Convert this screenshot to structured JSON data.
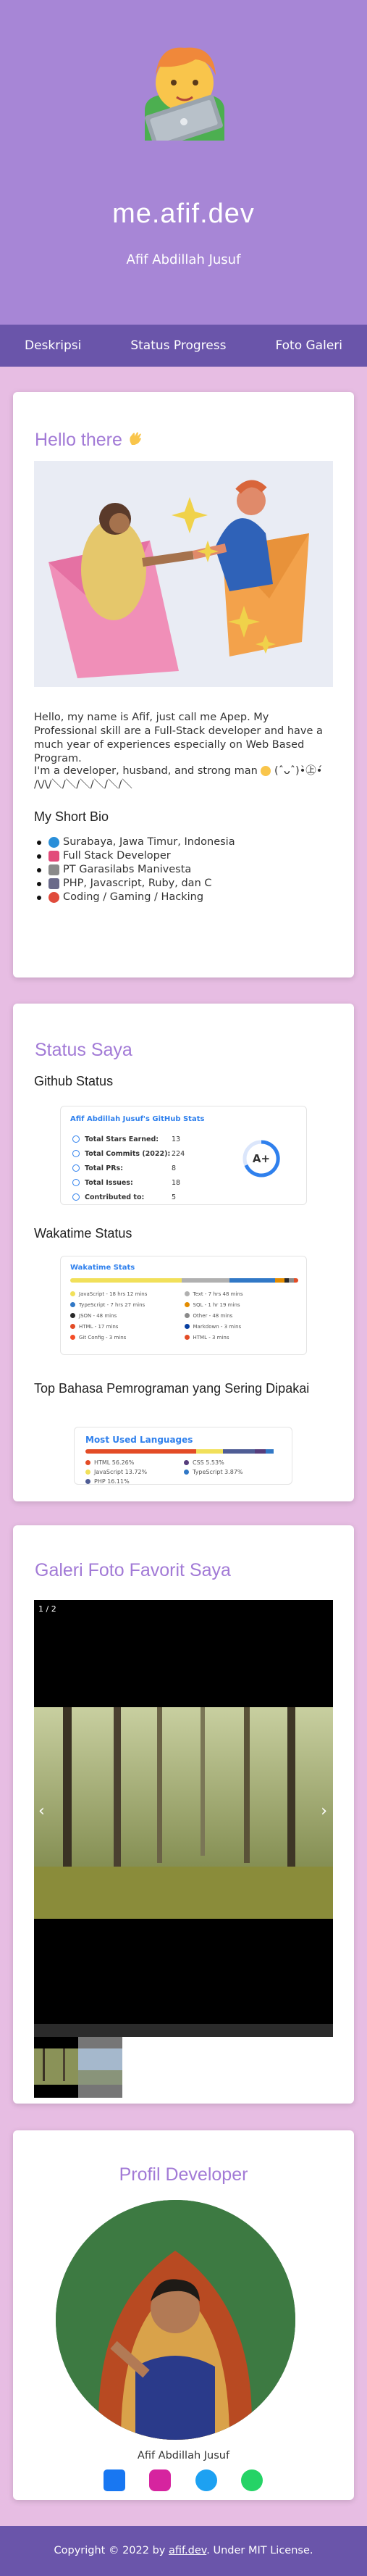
{
  "site": {
    "title": "me.afif.dev",
    "subtitle": "Afif Abdillah Jusuf"
  },
  "nav": [
    {
      "label": "Deskripsi"
    },
    {
      "label": "Status Progress"
    },
    {
      "label": "Foto Galeri"
    }
  ],
  "hello": {
    "heading": "Hello there",
    "intro": "Hello, my name is Afif, just call me Apep. My Professional skill are a Full-Stack developer and have a much year of experiences especially on Web Based Program.",
    "tagline_start": "I'm a developer, husband, and strong man",
    "tagline_end": "(ˆᴗˆ)•̀㊤•́ /\\/\\/＼/＼/＼/＼/＼/＼",
    "bio_heading": "My Short Bio",
    "bio": [
      {
        "text": "Surabaya, Jawa Timur, Indonesia",
        "icon": "globe-icon",
        "color": "#2a8fd9"
      },
      {
        "text": "Full Stack Developer",
        "icon": "sparkles-icon",
        "color": "#e24b7a"
      },
      {
        "text": "PT Garasilabs Manivesta",
        "icon": "building-icon",
        "color": "#8a8a8a"
      },
      {
        "text": "PHP, Javascript, Ruby, dan C",
        "icon": "laptop-icon",
        "color": "#6a6a8a"
      },
      {
        "text": "Coding / Gaming / Hacking",
        "icon": "target-icon",
        "color": "#e04b3c"
      }
    ]
  },
  "status": {
    "heading": "Status Saya",
    "github_heading": "Github Status",
    "github_card": {
      "title": "Afif Abdillah Jusuf's GitHub Stats",
      "rows": [
        {
          "label": "Total Stars Earned:",
          "value": "13"
        },
        {
          "label": "Total Commits (2022):",
          "value": "224"
        },
        {
          "label": "Total PRs:",
          "value": "8"
        },
        {
          "label": "Total Issues:",
          "value": "18"
        },
        {
          "label": "Contributed to:",
          "value": "5"
        }
      ],
      "grade": "A+"
    },
    "wakatime_heading": "Wakatime Status",
    "wakatime_card": {
      "title": "Wakatime Stats",
      "items": [
        {
          "name": "JavaScript - 18 hrs 12 mins",
          "color": "#f1e05a"
        },
        {
          "name": "Text - 7 hrs 48 mins",
          "color": "#b0b0b0"
        },
        {
          "name": "TypeScript - 7 hrs 27 mins",
          "color": "#3178c6"
        },
        {
          "name": "SQL - 1 hr 19 mins",
          "color": "#e38c00"
        },
        {
          "name": "JSON - 48 mins",
          "color": "#292929"
        },
        {
          "name": "Other - 48 mins",
          "color": "#8a8a8a"
        },
        {
          "name": "HTML - 17 mins",
          "color": "#e34c26"
        },
        {
          "name": "Markdown - 3 mins",
          "color": "#083fa1"
        },
        {
          "name": "Git Config - 3 mins",
          "color": "#f44d27"
        },
        {
          "name": "HTML - 3 mins",
          "color": "#e34c26"
        }
      ],
      "bar": [
        {
          "share": 0.49,
          "color": "#f1e05a"
        },
        {
          "share": 0.21,
          "color": "#b0b0b0"
        },
        {
          "share": 0.2,
          "color": "#3178c6"
        },
        {
          "share": 0.04,
          "color": "#e38c00"
        },
        {
          "share": 0.02,
          "color": "#292929"
        },
        {
          "share": 0.02,
          "color": "#8a8a8a"
        },
        {
          "share": 0.02,
          "color": "#e34c26"
        }
      ]
    },
    "lang_heading": "Top Bahasa Pemrograman yang Sering Dipakai",
    "lang_card": {
      "title": "Most Used Languages",
      "items": [
        {
          "name": "HTML 56.26%",
          "color": "#e34c26"
        },
        {
          "name": "CSS 5.53%",
          "color": "#563d7c"
        },
        {
          "name": "JavaScript 13.72%",
          "color": "#f1e05a"
        },
        {
          "name": "TypeScript 3.87%",
          "color": "#3178c6"
        },
        {
          "name": "PHP 16.11%",
          "color": "#4f5d95"
        }
      ],
      "bar": [
        {
          "share": 0.5626,
          "color": "#e34c26"
        },
        {
          "share": 0.1372,
          "color": "#f1e05a"
        },
        {
          "share": 0.1611,
          "color": "#4f5d95"
        },
        {
          "share": 0.0553,
          "color": "#563d7c"
        },
        {
          "share": 0.0387,
          "color": "#3178c6"
        }
      ]
    }
  },
  "gallery": {
    "heading": "Galeri Foto Favorit Saya",
    "counter": "1 / 2",
    "prev": "‹",
    "next": "›"
  },
  "profile": {
    "heading": "Profil Developer",
    "name": "Afif Abdillah Jusuf",
    "socials": [
      {
        "icon": "facebook-icon",
        "color": "#1877f2"
      },
      {
        "icon": "instagram-icon",
        "color": "#d6249f"
      },
      {
        "icon": "twitter-icon",
        "color": "#1da1f2"
      },
      {
        "icon": "whatsapp-icon",
        "color": "#25d366"
      }
    ]
  },
  "footer": {
    "prefix": "Copyright © 2022 by ",
    "link": "afif.dev",
    "suffix": ". Under MIT License."
  }
}
